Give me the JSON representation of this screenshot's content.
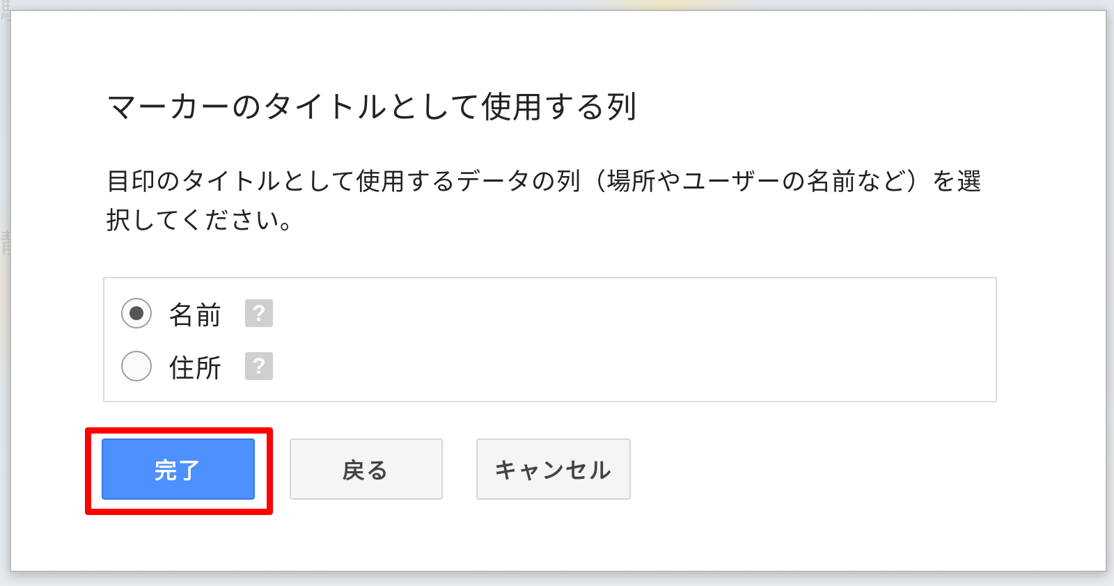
{
  "dialog": {
    "title": "マーカーのタイトルとして使用する列",
    "description": "目印のタイトルとして使用するデータの列（場所やユーザーの名前など）を選択してください。",
    "options": [
      {
        "label": "名前",
        "selected": true,
        "help_icon": "question-mark-icon"
      },
      {
        "label": "住所",
        "selected": false,
        "help_icon": "question-mark-icon"
      }
    ],
    "help_glyph": "?",
    "buttons": {
      "done": "完了",
      "back": "戻る",
      "cancel": "キャンセル"
    }
  },
  "colors": {
    "primary_button": "#4d90fe",
    "highlight": "#ff0000"
  }
}
